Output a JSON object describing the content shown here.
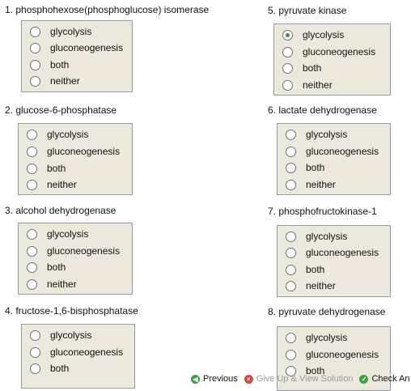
{
  "options": [
    "glycolysis",
    "gluconeogenesis",
    "both",
    "neither"
  ],
  "questions": [
    {
      "title": "1. phosphohexose(phosphoglucose) isomerase",
      "selected": null
    },
    {
      "title": "2. glucose-6-phosphatase",
      "selected": null
    },
    {
      "title": "3. alcohol dehydrogenase",
      "selected": null
    },
    {
      "title": "4. fructose-1,6-bisphosphatase",
      "selected": null
    },
    {
      "title": "5. pyruvate kinase",
      "selected": 0
    },
    {
      "title": "6. lactate dehydrogenase",
      "selected": null
    },
    {
      "title": "7. phosphofructokinase-1",
      "selected": null
    },
    {
      "title": "8. pyruvate dehydrogenase",
      "selected": null
    }
  ],
  "footer": {
    "previous": "Previous",
    "give_up": "Give Up & View Solution",
    "check": "Check An"
  },
  "colors": {
    "box_bg": "#ebe9dc",
    "selected_dot": "#2b9b38"
  }
}
